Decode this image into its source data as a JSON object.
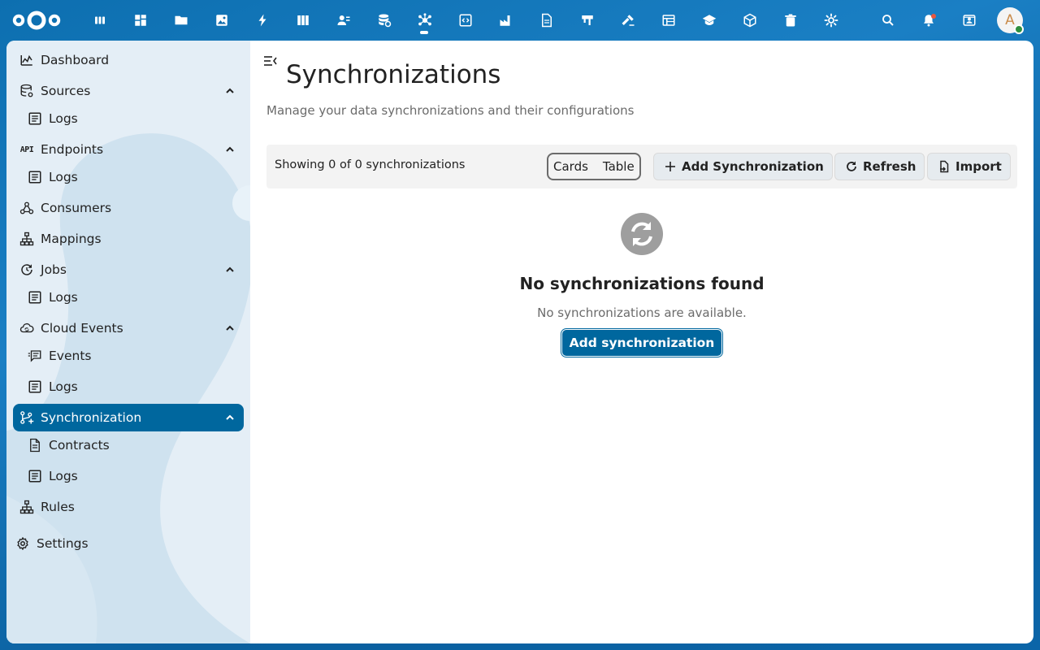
{
  "topbar": {
    "apps": [
      "dashboard-icon",
      "widgets-icon",
      "files-icon",
      "photos-icon",
      "activity-icon",
      "deck-icon",
      "contacts-icon",
      "database-sync-icon",
      "openconnector-icon",
      "code-icon",
      "factory-icon",
      "document-icon",
      "flag-icon",
      "hammer-icon",
      "table-icon",
      "education-icon",
      "cube-icon",
      "trash-icon",
      "settings-gear-icon"
    ],
    "avatar_initial": "A"
  },
  "sidebar": {
    "items": [
      {
        "label": "Dashboard",
        "icon": "chart-line-icon",
        "sub": false,
        "chevron": false,
        "active": false
      },
      {
        "label": "Sources",
        "icon": "database-cog-icon",
        "sub": false,
        "chevron": true,
        "active": false
      },
      {
        "label": "Logs",
        "icon": "log-text-icon",
        "sub": true,
        "chevron": false,
        "active": false
      },
      {
        "label": "Endpoints",
        "icon": "api-icon",
        "sub": false,
        "chevron": true,
        "active": false
      },
      {
        "label": "Logs",
        "icon": "log-text-icon",
        "sub": true,
        "chevron": false,
        "active": false
      },
      {
        "label": "Consumers",
        "icon": "webhook-icon",
        "sub": false,
        "chevron": false,
        "active": false
      },
      {
        "label": "Mappings",
        "icon": "sitemap-icon",
        "sub": false,
        "chevron": false,
        "active": false
      },
      {
        "label": "Jobs",
        "icon": "timer-refresh-icon",
        "sub": false,
        "chevron": true,
        "active": false
      },
      {
        "label": "Logs",
        "icon": "log-text-icon",
        "sub": true,
        "chevron": false,
        "active": false
      },
      {
        "label": "Cloud Events",
        "icon": "cloud-sync-icon",
        "sub": false,
        "chevron": true,
        "active": false
      },
      {
        "label": "Events",
        "icon": "message-list-icon",
        "sub": true,
        "chevron": false,
        "active": false
      },
      {
        "label": "Logs",
        "icon": "log-text-icon",
        "sub": true,
        "chevron": false,
        "active": false
      },
      {
        "label": "Synchronization",
        "icon": "source-branch-sync-icon",
        "sub": false,
        "chevron": true,
        "active": true
      },
      {
        "label": "Contracts",
        "icon": "file-document-icon",
        "sub": true,
        "chevron": false,
        "active": false
      },
      {
        "label": "Logs",
        "icon": "log-text-icon",
        "sub": true,
        "chevron": false,
        "active": false
      },
      {
        "label": "Rules",
        "icon": "sitemap-icon",
        "sub": false,
        "chevron": false,
        "active": false
      }
    ],
    "settings_label": "Settings"
  },
  "main": {
    "title": "Synchronizations",
    "subtitle": "Manage your data synchronizations and their configurations",
    "toolbar": {
      "showing": "Showing 0 of 0 synchronizations",
      "view_cards": "Cards",
      "view_table": "Table",
      "add_label": "Add Synchronization",
      "refresh_label": "Refresh",
      "import_label": "Import"
    },
    "empty": {
      "title": "No synchronizations found",
      "description": "No synchronizations are available.",
      "button": "Add synchronization"
    }
  },
  "colors": {
    "primary": "#00679e",
    "header": "#0b6aac"
  }
}
